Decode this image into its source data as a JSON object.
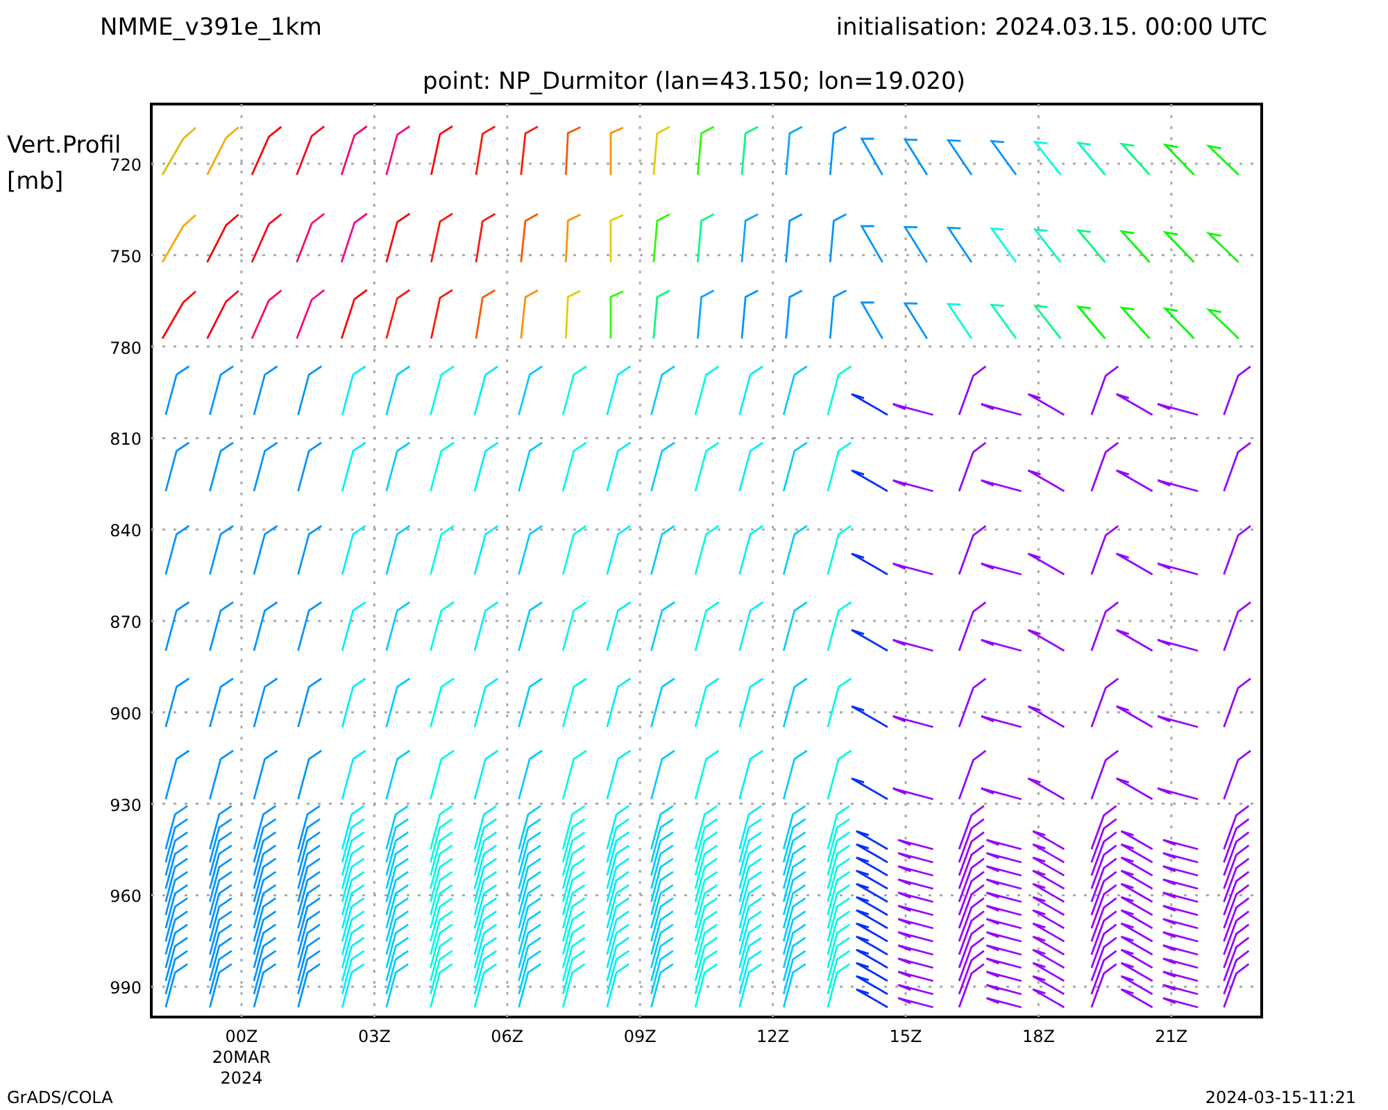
{
  "header": {
    "model": "NMME_v391e_1km",
    "initialisation": "initialisation: 2024.03.15. 00:00 UTC"
  },
  "plot": {
    "title": "point: NP_Durmitor (lan=43.150; lon=19.020)",
    "y_axis": {
      "label_lines": [
        "Vert.Profil",
        "[mb]"
      ],
      "ticks": [
        "720",
        "750",
        "780",
        "810",
        "840",
        "870",
        "900",
        "930",
        "960",
        "990"
      ]
    },
    "x_axis": {
      "ticks": [
        {
          "label": "00Z",
          "sub": [
            "20MAR",
            "2024"
          ]
        },
        {
          "label": "03Z"
        },
        {
          "label": "06Z"
        },
        {
          "label": "09Z"
        },
        {
          "label": "12Z"
        },
        {
          "label": "15Z"
        },
        {
          "label": "18Z"
        },
        {
          "label": "21Z"
        }
      ]
    }
  },
  "footer": {
    "left": "GrADS/COLA",
    "right": "2024-03-15-11:21"
  }
}
